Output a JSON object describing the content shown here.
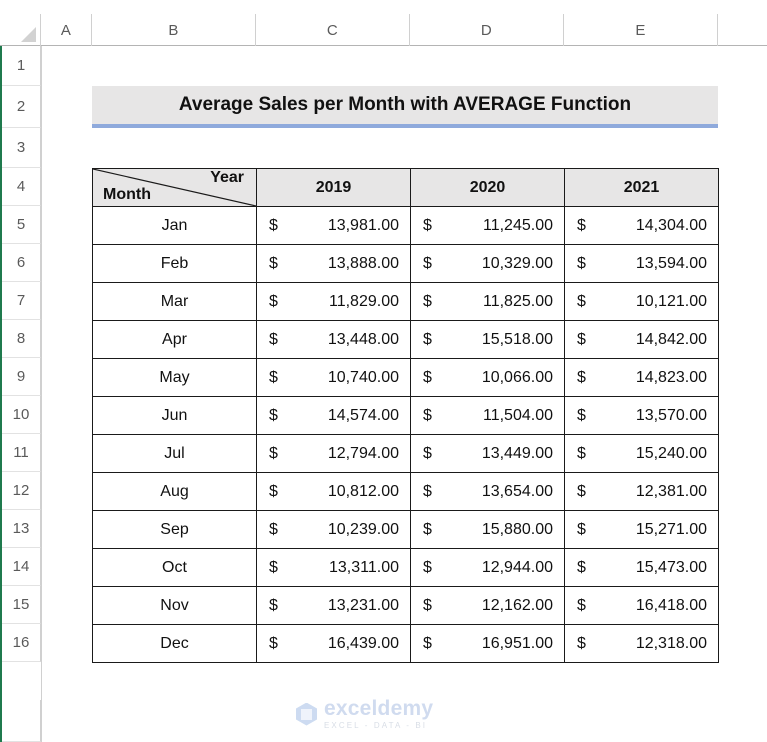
{
  "app": {
    "type": "spreadsheet",
    "column_headers": [
      "A",
      "B",
      "C",
      "D",
      "E"
    ],
    "row_numbers": [
      "1",
      "2",
      "3",
      "4",
      "5",
      "6",
      "7",
      "8",
      "9",
      "10",
      "11",
      "12",
      "13",
      "14",
      "15",
      "16"
    ],
    "select_all_icon": "select-all-triangle-icon"
  },
  "title": {
    "text": "Average Sales per Month with AVERAGE Function",
    "background": "#E7E6E6",
    "underline_color": "#8FAADC"
  },
  "table": {
    "corner": {
      "top_right_label": "Year",
      "bottom_left_label": "Month"
    },
    "headers": [
      "2019",
      "2020",
      "2021"
    ],
    "header_background": "#E7E6E6",
    "currency_symbol": "$",
    "rows": [
      {
        "month": "Jan",
        "values": [
          "13,981.00",
          "11,245.00",
          "14,304.00"
        ]
      },
      {
        "month": "Feb",
        "values": [
          "13,888.00",
          "10,329.00",
          "13,594.00"
        ]
      },
      {
        "month": "Mar",
        "values": [
          "11,829.00",
          "11,825.00",
          "10,121.00"
        ]
      },
      {
        "month": "Apr",
        "values": [
          "13,448.00",
          "15,518.00",
          "14,842.00"
        ]
      },
      {
        "month": "May",
        "values": [
          "10,740.00",
          "10,066.00",
          "14,823.00"
        ]
      },
      {
        "month": "Jun",
        "values": [
          "14,574.00",
          "11,504.00",
          "13,570.00"
        ]
      },
      {
        "month": "Jul",
        "values": [
          "12,794.00",
          "13,449.00",
          "15,240.00"
        ]
      },
      {
        "month": "Aug",
        "values": [
          "10,812.00",
          "13,654.00",
          "12,381.00"
        ]
      },
      {
        "month": "Sep",
        "values": [
          "10,239.00",
          "15,880.00",
          "15,271.00"
        ]
      },
      {
        "month": "Oct",
        "values": [
          "13,311.00",
          "12,944.00",
          "15,473.00"
        ]
      },
      {
        "month": "Nov",
        "values": [
          "13,231.00",
          "12,162.00",
          "16,418.00"
        ]
      },
      {
        "month": "Dec",
        "values": [
          "16,439.00",
          "16,951.00",
          "12,318.00"
        ]
      }
    ]
  },
  "watermark": {
    "name": "exceldemy",
    "tagline": "EXCEL - DATA - BI",
    "icon": "exceldemy-hexagon-logo-icon"
  },
  "chart_data": {
    "type": "table",
    "title": "Average Sales per Month with AVERAGE Function",
    "xlabel": "Month",
    "ylabel": "Year",
    "categories": [
      "Jan",
      "Feb",
      "Mar",
      "Apr",
      "May",
      "Jun",
      "Jul",
      "Aug",
      "Sep",
      "Oct",
      "Nov",
      "Dec"
    ],
    "series": [
      {
        "name": "2019",
        "values": [
          13981,
          13888,
          11829,
          13448,
          10740,
          14574,
          12794,
          10812,
          10239,
          13311,
          13231,
          16439
        ]
      },
      {
        "name": "2020",
        "values": [
          11245,
          10329,
          11825,
          15518,
          10066,
          11504,
          13449,
          13654,
          15880,
          12944,
          12162,
          16951
        ]
      },
      {
        "name": "2021",
        "values": [
          14304,
          13594,
          10121,
          14842,
          14823,
          13570,
          15240,
          12381,
          15271,
          15473,
          16418,
          12318
        ]
      }
    ]
  }
}
